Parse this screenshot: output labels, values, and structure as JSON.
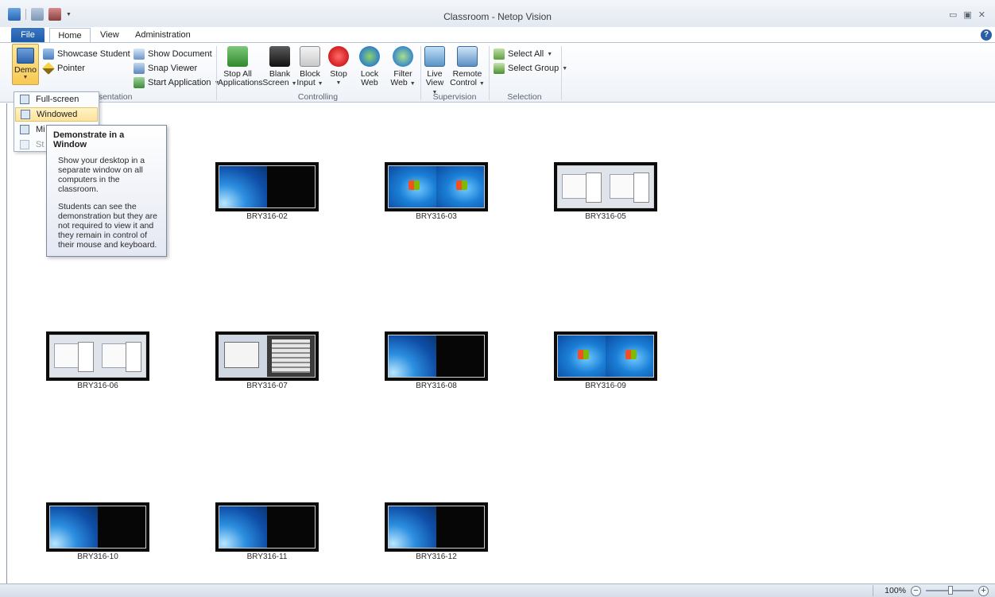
{
  "window": {
    "title": "Classroom - Netop Vision",
    "controls": [
      "minimize-icon",
      "restore-icon",
      "close-icon"
    ]
  },
  "tabs": {
    "file": "File",
    "home": "Home",
    "view": "View",
    "admin": "Administration"
  },
  "ribbon": {
    "presentation": {
      "demo": "Demo",
      "showcase": "Showcase Student",
      "pointer": "Pointer",
      "show_document": "Show Document",
      "snap_viewer": "Snap Viewer",
      "start_application": "Start Application",
      "label_fragment": "esentation"
    },
    "controlling": {
      "stop_all_1": "Stop All",
      "stop_all_2": "Applications",
      "blank_1": "Blank",
      "blank_2": "Screen",
      "block_1": "Block",
      "block_2": "Input",
      "stop": "Stop",
      "lock_1": "Lock",
      "lock_2": "Web",
      "filter_1": "Filter",
      "filter_2": "Web",
      "label": "Controlling"
    },
    "supervision": {
      "live_1": "Live",
      "live_2": "View",
      "remote_1": "Remote",
      "remote_2": "Control",
      "label": "Supervision"
    },
    "selection": {
      "select_all": "Select All",
      "select_group": "Select Group",
      "label": "Selection"
    }
  },
  "demo_menu": {
    "full": "Full-screen",
    "windowed": "Windowed",
    "third": "Mi",
    "fourth": "St"
  },
  "tooltip": {
    "title": "Demonstrate in a Window",
    "p1": "Show your desktop in a separate window on all computers in the classroom.",
    "p2": "Students can see the demonstration but they are not required to view it and they remain in control of their mouse and keyboard."
  },
  "computers": [
    {
      "name": "BRY316-02"
    },
    {
      "name": "BRY316-03"
    },
    {
      "name": "BRY316-05"
    },
    {
      "name": "BRY316-06"
    },
    {
      "name": "BRY316-07"
    },
    {
      "name": "BRY316-08"
    },
    {
      "name": "BRY316-09"
    },
    {
      "name": "BRY316-10"
    },
    {
      "name": "BRY316-11"
    },
    {
      "name": "BRY316-12"
    }
  ],
  "status": {
    "zoom": "100%"
  }
}
